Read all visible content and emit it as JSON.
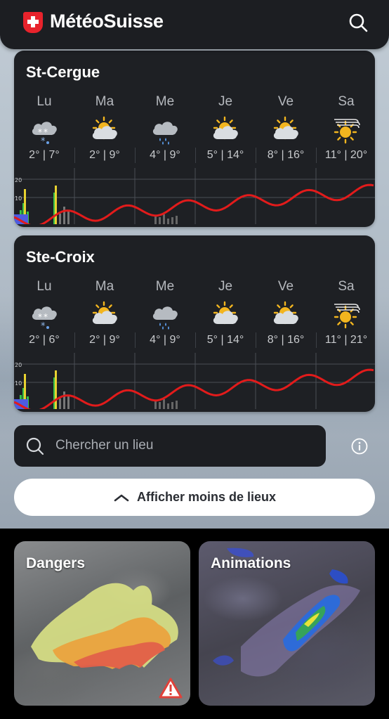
{
  "header": {
    "app_title": "MétéoSuisse",
    "brand_color": "#e8232c",
    "search_icon": "search-icon"
  },
  "locations": [
    {
      "name": "St-Cergue",
      "days": [
        {
          "label": "Lu",
          "icon": "snow-cloud-icon",
          "temps": "2° | 7°"
        },
        {
          "label": "Ma",
          "icon": "sun-cloud-icon",
          "temps": "2° | 9°"
        },
        {
          "label": "Me",
          "icon": "rain-cloud-icon",
          "temps": "4° | 9°"
        },
        {
          "label": "Je",
          "icon": "sun-cloud-icon",
          "temps": "5° | 14°"
        },
        {
          "label": "Ve",
          "icon": "sun-cloud-icon",
          "temps": "8° | 16°"
        },
        {
          "label": "Sa",
          "icon": "sun-wind-icon",
          "temps": "11° | 20°"
        }
      ],
      "chart": {
        "y_ticks": [
          "20",
          "10"
        ]
      }
    },
    {
      "name": "Ste-Croix",
      "days": [
        {
          "label": "Lu",
          "icon": "snow-cloud-icon",
          "temps": "2° | 6°"
        },
        {
          "label": "Ma",
          "icon": "sun-cloud-icon",
          "temps": "2° | 9°"
        },
        {
          "label": "Me",
          "icon": "rain-cloud-icon",
          "temps": "4° | 9°"
        },
        {
          "label": "Je",
          "icon": "sun-cloud-icon",
          "temps": "5° | 14°"
        },
        {
          "label": "Ve",
          "icon": "sun-cloud-icon",
          "temps": "8° | 16°"
        },
        {
          "label": "Sa",
          "icon": "sun-wind-icon",
          "temps": "11° | 21°"
        }
      ],
      "chart": {
        "y_ticks": [
          "20",
          "10"
        ]
      }
    }
  ],
  "search": {
    "placeholder": "Chercher un lieu",
    "info_icon": "info-icon"
  },
  "show_less": {
    "label": "Afficher moins de lieux",
    "icon": "chevron-up-icon"
  },
  "tiles": [
    {
      "title": "Dangers",
      "badge_icon": "warning-icon"
    },
    {
      "title": "Animations"
    }
  ]
}
